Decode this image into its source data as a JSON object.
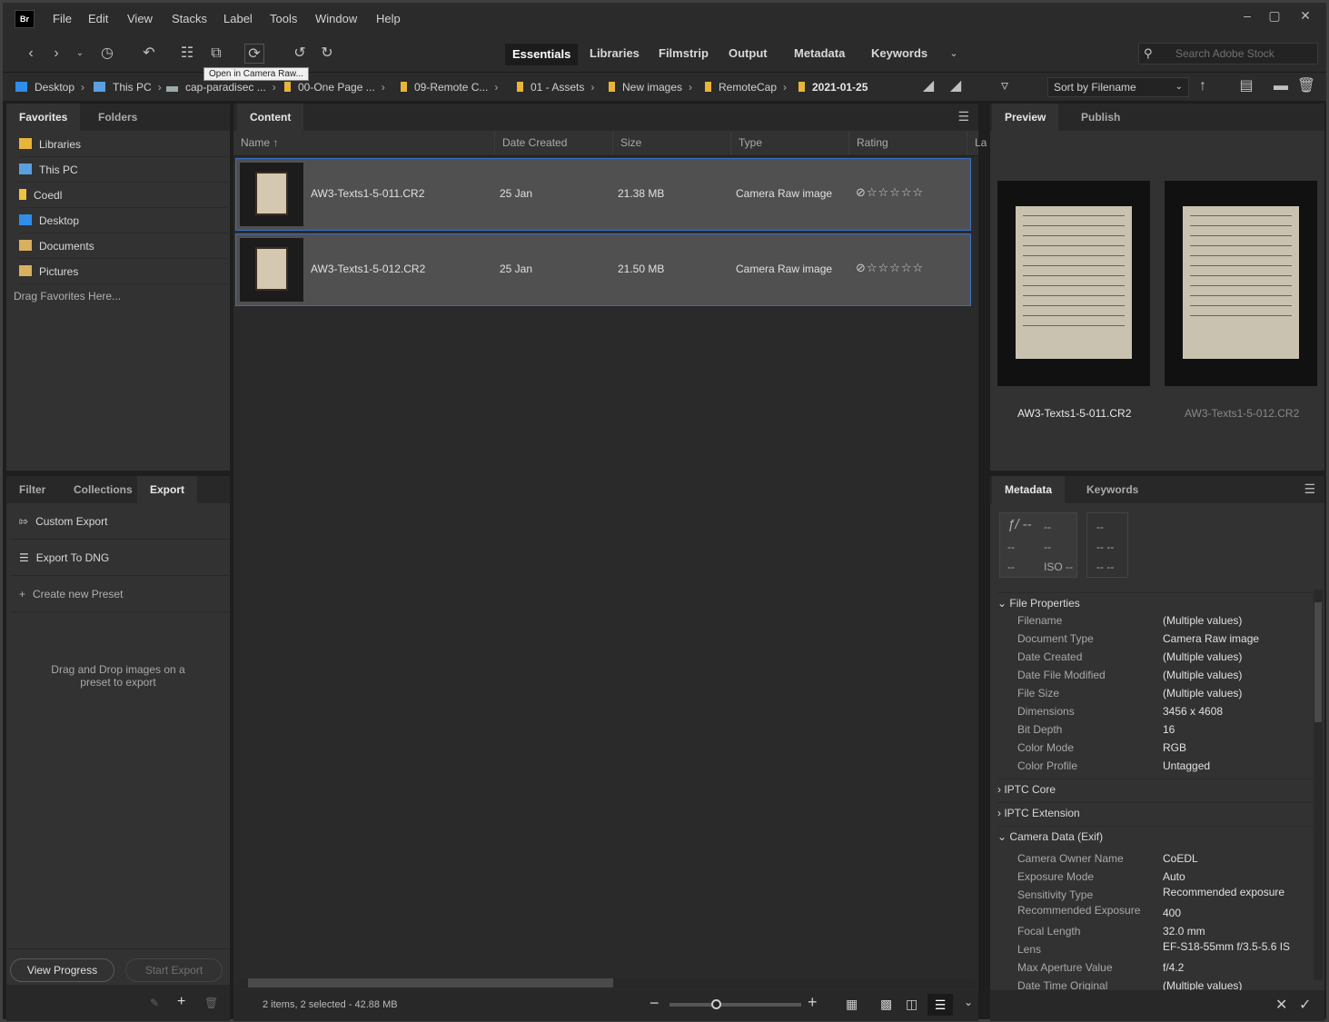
{
  "app": {
    "logo": "Br"
  },
  "menu": [
    "File",
    "Edit",
    "View",
    "Stacks",
    "Label",
    "Tools",
    "Window",
    "Help"
  ],
  "toolbar": {
    "workspaces": [
      "Essentials",
      "Libraries",
      "Filmstrip",
      "Output",
      "Metadata",
      "Keywords"
    ],
    "active_workspace": "Essentials",
    "search_placeholder": "Search Adobe Stock",
    "tooltip": "Open in Camera Raw..."
  },
  "breadcrumb": [
    "Desktop",
    "This PC",
    "cap-paradisec ...",
    "00-One Page ...",
    "09-Remote C...",
    "01 - Assets",
    "New images",
    "RemoteCap",
    "2021-01-25"
  ],
  "sort": {
    "label": "Sort by Filename"
  },
  "left_panel": {
    "tabs": [
      "Favorites",
      "Folders"
    ],
    "favorites": [
      "Libraries",
      "This PC",
      "Coedl",
      "Desktop",
      "Documents",
      "Pictures"
    ],
    "drag_hint": "Drag Favorites Here...",
    "lower_tabs": [
      "Filter",
      "Collections",
      "Export"
    ],
    "export_items": [
      "Custom Export",
      "Export To DNG",
      "Create new Preset"
    ],
    "export_hint_1": "Drag and Drop images on a",
    "export_hint_2": "preset to export",
    "view_progress": "View Progress",
    "start_export": "Start Export"
  },
  "content": {
    "tab": "Content",
    "columns": [
      "Name",
      "Date Created",
      "Size",
      "Type",
      "Rating",
      "La"
    ],
    "rows": [
      {
        "name": "AW3-Texts1-5-011.CR2",
        "date": "25 Jan",
        "size": "21.38 MB",
        "type": "Camera Raw image",
        "rating": "☆☆☆☆☆"
      },
      {
        "name": "AW3-Texts1-5-012.CR2",
        "date": "25 Jan",
        "size": "21.50 MB",
        "type": "Camera Raw image",
        "rating": "☆☆☆☆☆"
      }
    ],
    "status": "2 items, 2 selected - 42.88 MB"
  },
  "preview": {
    "tabs": [
      "Preview",
      "Publish"
    ],
    "names": [
      "AW3-Texts1-5-011.CR2",
      "AW3-Texts1-5-012.CR2"
    ]
  },
  "metadata": {
    "tabs": [
      "Metadata",
      "Keywords"
    ],
    "exposure": {
      "f": "ƒ/ --",
      "shutter": "--",
      "a": "--",
      "b": "--",
      "c": "--",
      "iso": "ISO --",
      "r1": "--",
      "r2": "-- --",
      "r3": "-- --"
    },
    "file_properties_title": "File Properties",
    "file_properties": [
      {
        "k": "Filename",
        "v": "(Multiple values)"
      },
      {
        "k": "Document Type",
        "v": "Camera Raw image"
      },
      {
        "k": "Date Created",
        "v": "(Multiple values)"
      },
      {
        "k": "Date File Modified",
        "v": "(Multiple values)"
      },
      {
        "k": "File Size",
        "v": "(Multiple values)"
      },
      {
        "k": "Dimensions",
        "v": "3456 x 4608"
      },
      {
        "k": "Bit Depth",
        "v": "16"
      },
      {
        "k": "Color Mode",
        "v": "RGB"
      },
      {
        "k": "Color Profile",
        "v": "Untagged"
      }
    ],
    "iptc_core": "IPTC Core",
    "iptc_ext": "IPTC Extension",
    "camera_title": "Camera Data (Exif)",
    "camera": [
      {
        "k": "Camera Owner Name",
        "v": "CoEDL"
      },
      {
        "k": "Exposure Mode",
        "v": "Auto"
      },
      {
        "k": "Sensitivity Type",
        "v": "Recommended exposure"
      },
      {
        "k": "Recommended Exposure",
        "v": "400"
      },
      {
        "k": "Focal Length",
        "v": "32.0 mm"
      },
      {
        "k": "Lens",
        "v": "EF-S18-55mm f/3.5-5.6 IS"
      },
      {
        "k": "Max Aperture Value",
        "v": "f/4.2"
      },
      {
        "k": "Date Time Original",
        "v": "(Multiple values)"
      }
    ]
  }
}
